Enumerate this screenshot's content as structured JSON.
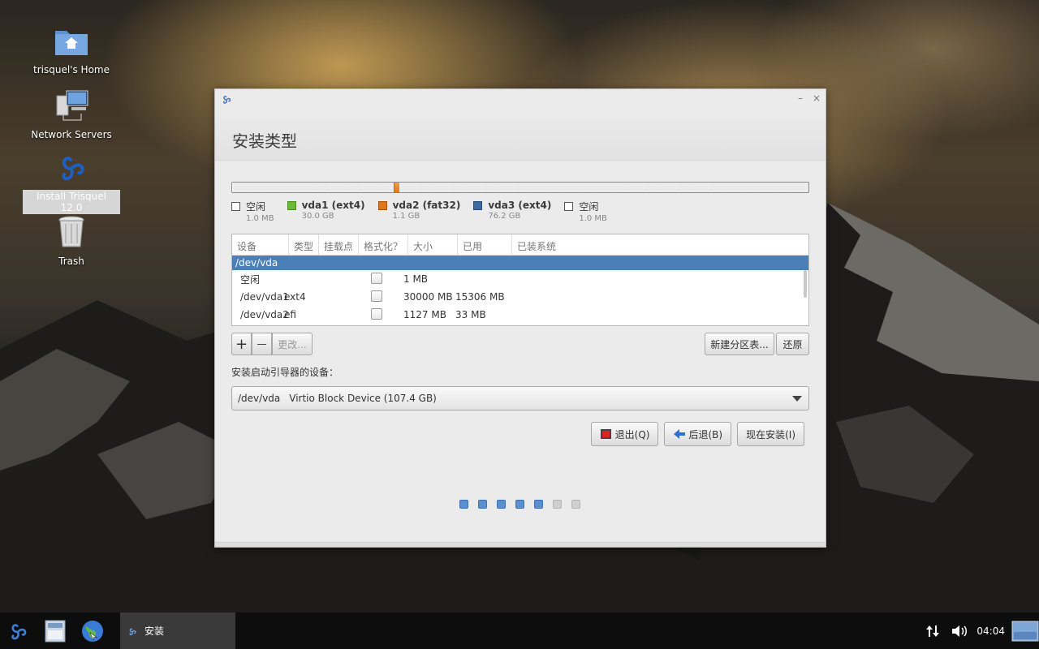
{
  "desktop": {
    "icons": [
      {
        "label": "trisquel's Home",
        "icon": "home-folder-icon"
      },
      {
        "label": "Network Servers",
        "icon": "network-servers-icon"
      },
      {
        "label": "Install Trisquel 12.0",
        "icon": "trisquel-logo-icon"
      },
      {
        "label": "Trash",
        "icon": "trash-icon"
      }
    ]
  },
  "window": {
    "title": "安装类型",
    "controls": {
      "minimize": "–",
      "close": "×"
    },
    "legend": [
      {
        "name": "空闲",
        "size": "1.0 MB",
        "color": "#ffffff"
      },
      {
        "name": "vda1 (ext4)",
        "size": "30.0 GB",
        "color": "#6cba38"
      },
      {
        "name": "vda2 (fat32)",
        "size": "1.1 GB",
        "color": "#e07618"
      },
      {
        "name": "vda3 (ext4)",
        "size": "76.2 GB",
        "color": "#3d6aa3"
      },
      {
        "name": "空闲",
        "size": "1.0 MB",
        "color": "#ffffff"
      }
    ],
    "table": {
      "headers": [
        "设备",
        "类型",
        "挂载点",
        "格式化？",
        "大小",
        "已用",
        "已装系统"
      ],
      "selected_row": "/dev/vda",
      "rows": [
        {
          "device": "空闲",
          "type": "",
          "mount": "",
          "size": "1 MB",
          "used": ""
        },
        {
          "device": "/dev/vda1",
          "type": "ext4",
          "mount": "",
          "size": "30000 MB",
          "used": "15306 MB"
        },
        {
          "device": "/dev/vda2",
          "type": "efi",
          "mount": "",
          "size": "1127 MB",
          "used": "33 MB"
        }
      ]
    },
    "tools": {
      "add": "+",
      "remove": "—",
      "change": "更改...",
      "new_table": "新建分区表...",
      "revert": "还原"
    },
    "boot_label": "安装启动引导器的设备：",
    "boot_device": {
      "device": "/dev/vda",
      "description": "Virtio Block Device (107.4 GB)"
    },
    "buttons": {
      "quit": "退出(Q)",
      "back": "后退(B)",
      "install": "现在安装(I)"
    },
    "progress": {
      "total_steps": 7,
      "completed_steps": 5
    }
  },
  "taskbar": {
    "task_label": "安装",
    "clock": "04:04"
  }
}
